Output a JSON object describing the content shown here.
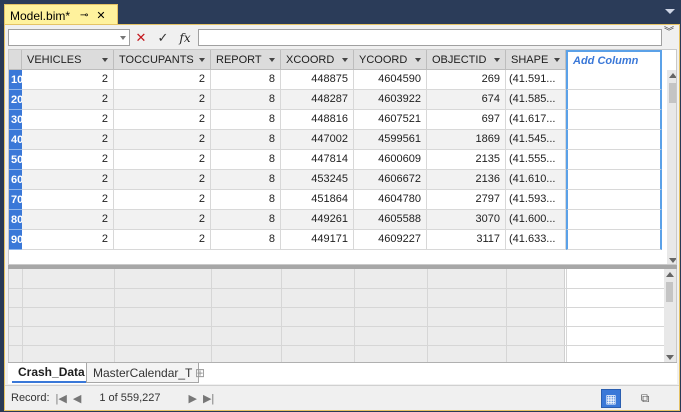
{
  "document_tab": {
    "title": "Model.bim*",
    "pin": "⊸",
    "close": "✕"
  },
  "formula_bar": {
    "cancel": "✕",
    "confirm": "✓",
    "fx": "fx"
  },
  "columns": [
    {
      "label": "",
      "width": 13
    },
    {
      "label": "VEHICLES",
      "width": 92
    },
    {
      "label": "TOCCUPANTS",
      "width": 97
    },
    {
      "label": "REPORT",
      "width": 70
    },
    {
      "label": "XCOORD",
      "width": 73
    },
    {
      "label": "YCOORD",
      "width": 73
    },
    {
      "label": "OBJECTID",
      "width": 79
    },
    {
      "label": "SHAPE",
      "width": 60
    },
    {
      "label": "Add Column",
      "width": 96
    }
  ],
  "rows": [
    {
      "num": "1",
      "prefix": "0",
      "vehicles": "2",
      "toccupants": "2",
      "report": "8",
      "xcoord": "448875",
      "ycoord": "4604590",
      "objectid": "269",
      "shape": "(41.591..."
    },
    {
      "num": "2",
      "prefix": "0",
      "vehicles": "2",
      "toccupants": "2",
      "report": "8",
      "xcoord": "448287",
      "ycoord": "4603922",
      "objectid": "674",
      "shape": "(41.585..."
    },
    {
      "num": "3",
      "prefix": "0",
      "vehicles": "2",
      "toccupants": "2",
      "report": "8",
      "xcoord": "448816",
      "ycoord": "4607521",
      "objectid": "697",
      "shape": "(41.617..."
    },
    {
      "num": "4",
      "prefix": "0",
      "vehicles": "2",
      "toccupants": "2",
      "report": "8",
      "xcoord": "447002",
      "ycoord": "4599561",
      "objectid": "1869",
      "shape": "(41.545..."
    },
    {
      "num": "5",
      "prefix": "0",
      "vehicles": "2",
      "toccupants": "2",
      "report": "8",
      "xcoord": "447814",
      "ycoord": "4600609",
      "objectid": "2135",
      "shape": "(41.555..."
    },
    {
      "num": "6",
      "prefix": "0",
      "vehicles": "2",
      "toccupants": "2",
      "report": "8",
      "xcoord": "453245",
      "ycoord": "4606672",
      "objectid": "2136",
      "shape": "(41.610..."
    },
    {
      "num": "7",
      "prefix": "0",
      "vehicles": "2",
      "toccupants": "2",
      "report": "8",
      "xcoord": "451864",
      "ycoord": "4604780",
      "objectid": "2797",
      "shape": "(41.593..."
    },
    {
      "num": "8",
      "prefix": "0",
      "vehicles": "2",
      "toccupants": "2",
      "report": "8",
      "xcoord": "449261",
      "ycoord": "4605588",
      "objectid": "3070",
      "shape": "(41.600..."
    },
    {
      "num": "9",
      "prefix": "0",
      "vehicles": "2",
      "toccupants": "2",
      "report": "8",
      "xcoord": "449171",
      "ycoord": "4609227",
      "objectid": "3117",
      "shape": "(41.633..."
    }
  ],
  "sheet_tabs": {
    "active": "Crash_Data",
    "inactive": "MasterCalendar_T"
  },
  "status": {
    "label": "Record:",
    "record_text": "1 of 559,227"
  }
}
